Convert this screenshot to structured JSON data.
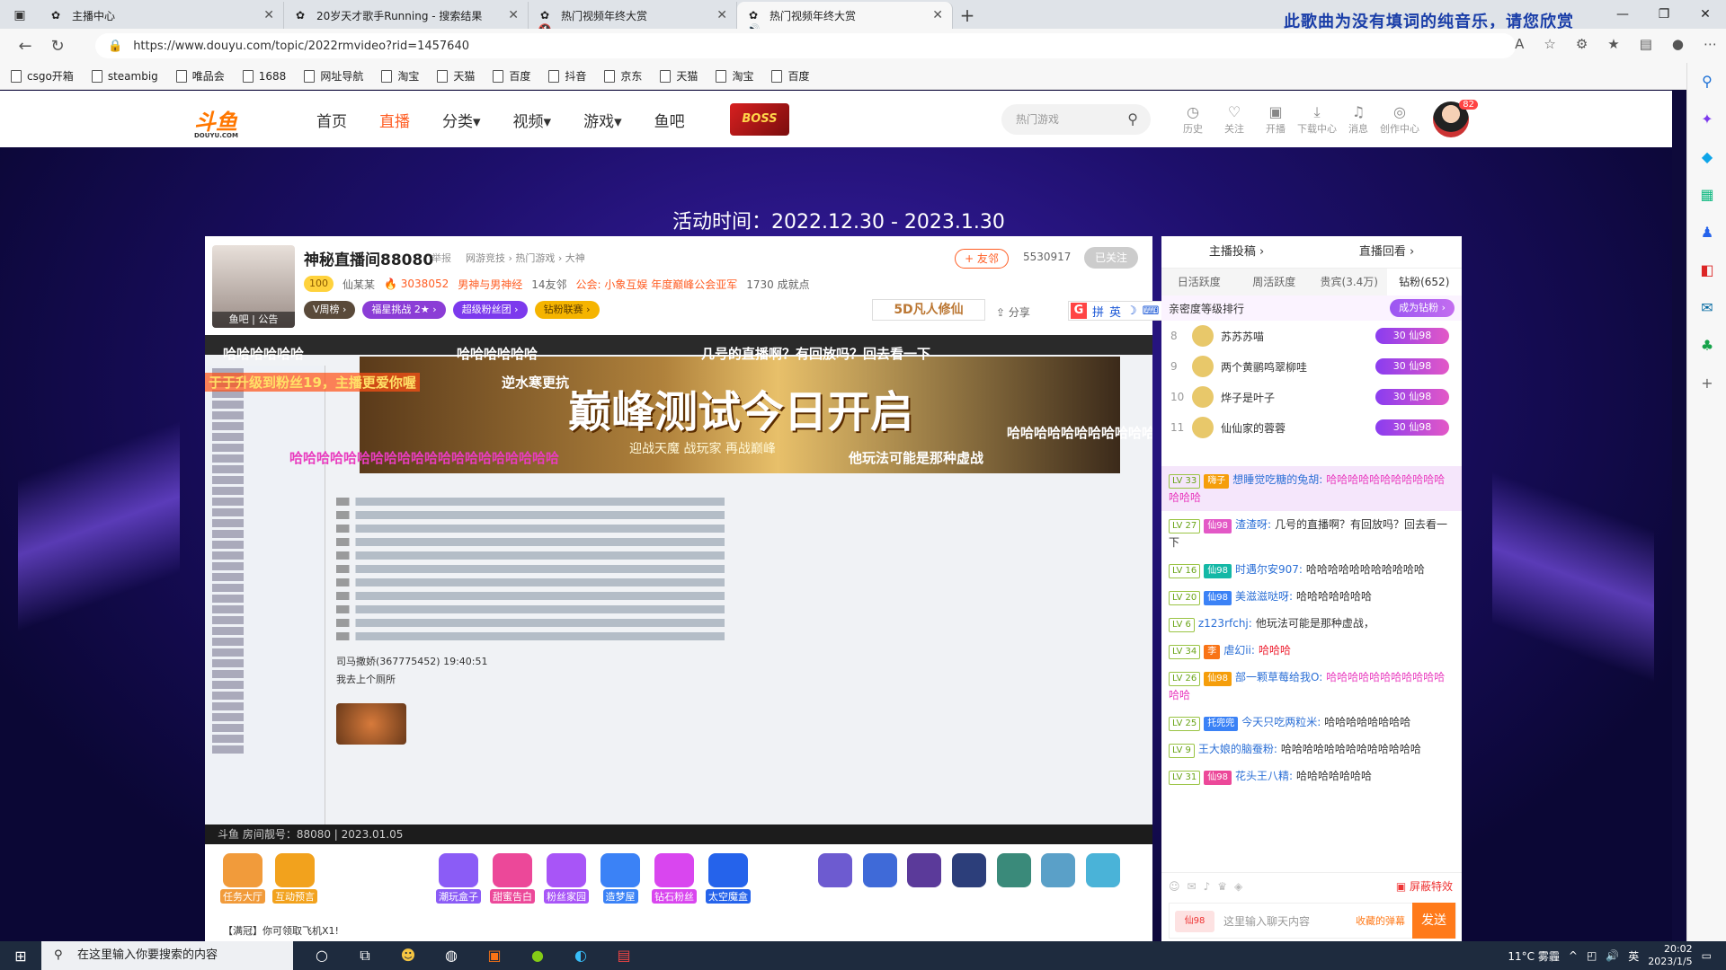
{
  "browser": {
    "tabs": [
      {
        "title": "主播中心",
        "active": false
      },
      {
        "title": "20岁天才歌手Running - 搜索结果",
        "active": false
      },
      {
        "title": "热门视频年终大赏",
        "active": false
      },
      {
        "title": "热门视频年终大赏",
        "active": true
      }
    ],
    "marquee": "此歌曲为没有填词的纯音乐，请您欣赏",
    "url": "https://www.douyu.com/topic/2022rmvideo?rid=1457640",
    "bookmarks": [
      "csgo开箱",
      "steambig",
      "唯品会",
      "1688",
      "网址导航",
      "淘宝",
      "天猫",
      "百度",
      "抖音",
      "京东",
      "天猫",
      "淘宝",
      "百度"
    ]
  },
  "header": {
    "logo": "斗鱼",
    "logo_sub": "DOUYU.COM",
    "nav": [
      "首页",
      "直播",
      "分类▾",
      "视频▾",
      "游戏▾",
      "鱼吧"
    ],
    "active_nav": "直播",
    "boss_badge": "BOSS",
    "search_placeholder": "热门游戏",
    "icons": [
      "历史",
      "关注",
      "开播",
      "下载中心",
      "消息",
      "创作中心"
    ],
    "avatar_count": "82"
  },
  "event": {
    "time": "活动时间：2022.12.30 - 2023.1.30"
  },
  "room": {
    "title": "神秘直播间88080",
    "report": "举报",
    "crumbs": "网游竞技 › 热门游戏 › 大神",
    "anchor_label": "鱼吧 | 公告",
    "level": "100",
    "anchor_name": "仙某某",
    "hot": "3038052",
    "tag": "男神与男神经",
    "friends": "14友邻",
    "guild": "公会: 小象互娱 年度巅峰公会亚军",
    "achievements": "1730 成就点",
    "buttons": [
      "V周榜 ›",
      "福星挑战 2★ ›",
      "超级粉丝团 ›",
      "钻粉联赛 ›"
    ],
    "friend_btn": "+ 友邻",
    "follow_count": "5530917",
    "followed_btn": "已关注",
    "sponsor": "5D凡人修仙",
    "share": "分享",
    "ime": [
      "拼",
      "英"
    ]
  },
  "video": {
    "banner_title": "巅峰测试今日开启",
    "banner_sub": "迎战天魔 战玩家 再战巅峰",
    "danmaku": [
      {
        "text": "哈哈哈哈哈哈",
        "color": "#ffffff"
      },
      {
        "text": "哈哈哈哈哈哈",
        "color": "#ffffff"
      },
      {
        "text": "几号的直播啊？有回放吗？回去看一下",
        "color": "#ffffff"
      },
      {
        "text": "于于升级到粉丝19，主播更爱你喔",
        "color": "#ffe066"
      },
      {
        "text": "逆水寒更抗",
        "color": "#ffffff"
      },
      {
        "text": "哈哈哈哈哈哈哈哈哈哈哈哈哈哈哈哈哈哈哈哈",
        "color": "#e93cbf"
      },
      {
        "text": "他玩法可能是那种虚战",
        "color": "#ffffff"
      },
      {
        "text": "哈哈哈哈哈哈哈哈哈哈哈哈",
        "color": "#ffffff"
      }
    ],
    "chat_name": "司马撒娇(367775452)  19:40:51",
    "chat_text": "我去上个厕所",
    "footer": "斗鱼 房间靓号：88080 | 2023.01.05",
    "timestamp": "88080"
  },
  "gifts": [
    {
      "label": "任务大厅",
      "color": "#f19b3b"
    },
    {
      "label": "互动预言",
      "color": "#f2a21d"
    },
    {
      "label": "潮玩盒子",
      "color": "#8b5cf6"
    },
    {
      "label": "甜蜜告白",
      "color": "#ec4899"
    },
    {
      "label": "粉丝家园",
      "color": "#a855f7"
    },
    {
      "label": "造梦屋",
      "color": "#3b82f6"
    },
    {
      "label": "钻石粉丝",
      "color": "#d946ef"
    },
    {
      "label": "太空魔盒",
      "color": "#2563eb"
    }
  ],
  "toast": "【满冠】你可领取飞机X1!",
  "side": {
    "tabs": [
      "主播投稿 ›",
      "直播回看 ›"
    ],
    "subtabs": [
      "日活跃度",
      "周活跃度",
      "贵宾(3.4万)",
      "钻粉(652)"
    ],
    "rank_title": "亲密度等级排行",
    "become_fan": "成为钻粉 ›",
    "ranks": [
      {
        "no": "8",
        "name": "苏苏苏喵",
        "badge": "30 仙98"
      },
      {
        "no": "9",
        "name": "两个黄鹂鸣翠柳哇",
        "badge": "30 仙98"
      },
      {
        "no": "10",
        "name": "烨子是叶子",
        "badge": "30 仙98"
      },
      {
        "no": "11",
        "name": "仙仙家的蓉蓉",
        "badge": "30 仙98"
      }
    ],
    "chat": [
      {
        "lv": "LV 33",
        "fan": "嗨子",
        "nick": "想睡觉吃糖的兔胡:",
        "msg": "哈哈哈哈哈哈哈哈哈哈哈哈哈哈",
        "style": "pink",
        "hl": true
      },
      {
        "lv": "LV 27",
        "fan": "仙98",
        "nick": "渣渣呀:",
        "msg": "几号的直播啊？有回放吗？回去看一下",
        "style": "",
        "hl": false
      },
      {
        "lv": "LV 16",
        "fan": "仙98",
        "nick": "时遇尔安907:",
        "msg": "哈哈哈哈哈哈哈哈哈哈哈",
        "style": "",
        "hl": false
      },
      {
        "lv": "LV 20",
        "fan": "仙98",
        "nick": "美滋滋哒呀:",
        "msg": "哈哈哈哈哈哈哈",
        "style": "",
        "hl": false
      },
      {
        "lv": "LV 6",
        "fan": "",
        "nick": "z123rfchj:",
        "msg": "他玩法可能是那种虚战，",
        "style": "",
        "hl": false
      },
      {
        "lv": "LV 34",
        "fan": "李",
        "nick": "虐幻ii:",
        "msg": "哈哈哈",
        "style": "red",
        "hl": false
      },
      {
        "lv": "LV 26",
        "fan": "仙98",
        "nick": "部一颗草莓给我O:",
        "msg": "哈哈哈哈哈哈哈哈哈哈哈哈哈",
        "style": "pink",
        "hl": false
      },
      {
        "lv": "LV 25",
        "fan": "托兜兜",
        "nick": "今天只吃两粒米:",
        "msg": "哈哈哈哈哈哈哈哈",
        "style": "",
        "hl": false
      },
      {
        "lv": "LV 9",
        "fan": "",
        "nick": "王大娘的脑蚕粉:",
        "msg": "哈哈哈哈哈哈哈哈哈哈哈哈哈",
        "style": "",
        "hl": false
      },
      {
        "lv": "LV 31",
        "fan": "仙98",
        "nick": "花头王八精:",
        "msg": "哈哈哈哈哈哈哈",
        "style": "",
        "hl": false
      }
    ],
    "block_label": "屏蔽特效",
    "input_placeholder": "这里输入聊天内容",
    "send": "发送",
    "collect": "收藏的弹幕",
    "fan_badge": "仙98"
  },
  "taskbar": {
    "search_placeholder": "在这里输入你要搜索的内容",
    "weather": "11°C 雾霾",
    "ime": "英",
    "time": "20:02",
    "date": "2023/1/5"
  }
}
